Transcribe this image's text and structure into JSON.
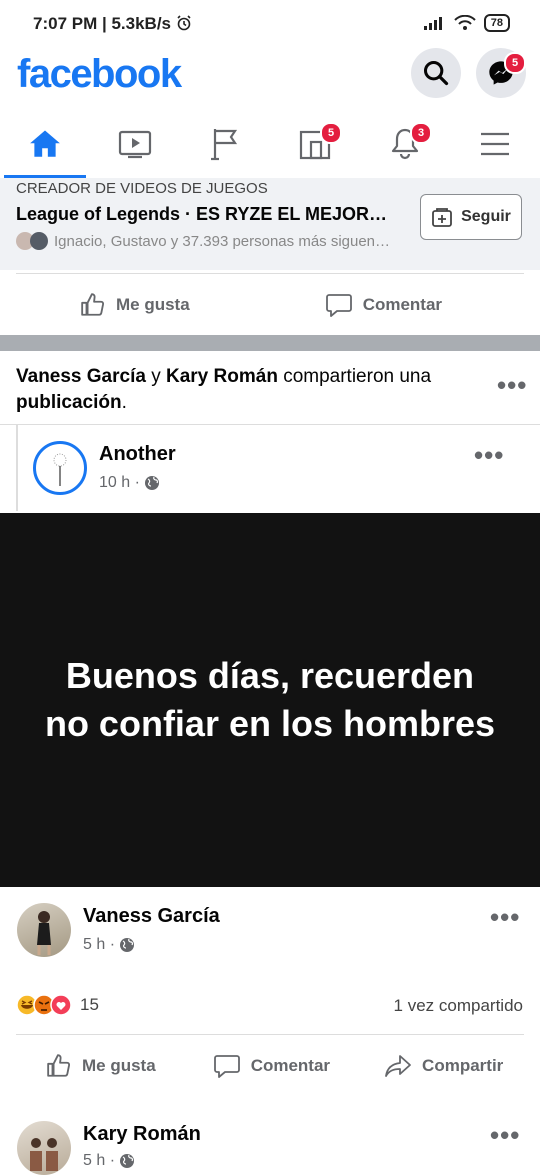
{
  "status_bar": {
    "time": "7:07 PM",
    "speed": "5.3kB/s",
    "battery": "78",
    "icons": [
      "alarm-icon",
      "signal-icon",
      "wifi-icon",
      "battery-icon"
    ]
  },
  "header": {
    "logo": "facebook",
    "messenger_badge": "5",
    "icons": [
      "search-icon",
      "messenger-icon"
    ]
  },
  "tabs": [
    {
      "name": "home",
      "icon": "home-icon",
      "active": true,
      "badge": ""
    },
    {
      "name": "watch",
      "icon": "video-icon",
      "active": false,
      "badge": ""
    },
    {
      "name": "pages",
      "icon": "flag-icon",
      "active": false,
      "badge": ""
    },
    {
      "name": "marketplace",
      "icon": "marketplace-icon",
      "active": false,
      "badge": "5"
    },
    {
      "name": "notifications",
      "icon": "bell-icon",
      "active": false,
      "badge": "3"
    },
    {
      "name": "menu",
      "icon": "menu-icon",
      "active": false,
      "badge": ""
    }
  ],
  "follow_strip": {
    "category": "CREADOR DE VIDEOS DE JUEGOS",
    "title": "League of Legends · ES RYZE EL MEJOR…",
    "followers": "Ignacio, Gustavo y 37.393 personas más siguen…",
    "follow_label": "Seguir"
  },
  "top_actions": {
    "like_label": "Me gusta",
    "comment_label": "Comentar"
  },
  "shared_post": {
    "context_name1": "Vaness García",
    "context_y": "y",
    "context_name2": "Kary Román",
    "context_rest": "compartieron una",
    "context_publicacion": "publicación",
    "context_dot": ".",
    "original": {
      "author": "Another",
      "time": "10 h ·",
      "text": "Buenos días, recuerden no confiar en los hombres",
      "background": "#121212"
    }
  },
  "sharer1": {
    "name": "Vaness García",
    "time": "5 h ·",
    "reactions_count": "15",
    "shares": "1 vez compartido",
    "like_label": "Me gusta",
    "comment_label": "Comentar",
    "share_label": "Compartir"
  },
  "sharer2": {
    "name": "Kary Román",
    "time": "5 h ·"
  },
  "colors": {
    "brand": "#1877f2",
    "badge": "#e41e3f"
  }
}
